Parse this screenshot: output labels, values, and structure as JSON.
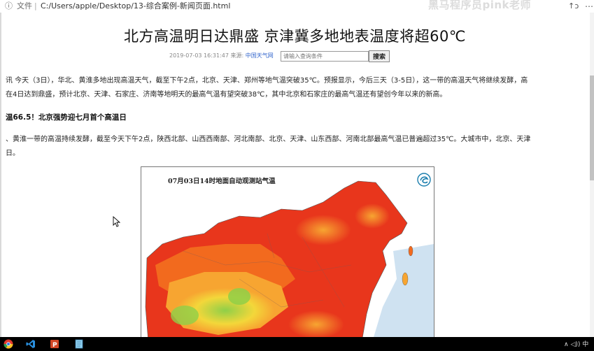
{
  "browser": {
    "file_label": "文件",
    "separator": "|",
    "url": "C:/Users/apple/Desktop/13-综合案例-新闻页面.html",
    "watermark": "黑马程序员pink老师",
    "ext_label": "↑ↄ",
    "menu_label": "⋯"
  },
  "article": {
    "title": "北方高温明日达鼎盛 京津冀多地地表温度将超60℃",
    "date": "2019-07-03 16:31:47",
    "source_prefix": "来源:",
    "source": "中国天气网",
    "search_placeholder": "请输入查询条件",
    "search_button": "搜索",
    "paragraph1_line1": "讯 今天（3日），华北、黄淮多地出现高温天气，截至下午2点，北京、天津、郑州等地气温突破35℃。预报显示，今后三天（3-5日），这一带的高温天气将继续发酵，高",
    "paragraph1_line2": "在4日达到鼎盛，预计北京、天津、石家庄、济南等地明天的最高气温有望突破38℃，其中北京和石家庄的最高气温还有望创今年以来的新高。",
    "subheading": "温66.5！北京强势迎七月首个高温日",
    "paragraph2_line1": "、黄淮一带的高温持续发酵，截至今天下午2点，陕西北部、山西西南部、河北南部、北京、天津、山东西部、河南北部最高气温已普遍超过35℃。大城市中，北京、天津",
    "paragraph2_line2": "日。"
  },
  "map": {
    "title": "07月03日14时地面自动观测站气温",
    "colors": {
      "hot": "#e8361c",
      "warm": "#f26a1e",
      "mid": "#f7a531",
      "cool": "#f3d73a",
      "cold": "#8fcf48",
      "sea": "#cfe2f1"
    }
  },
  "taskbar": {
    "apps": [
      "chrome-icon",
      "vscode-icon",
      "powerpoint-icon",
      "notepad-icon"
    ],
    "tray_text": "∧ ◁)) 中"
  }
}
